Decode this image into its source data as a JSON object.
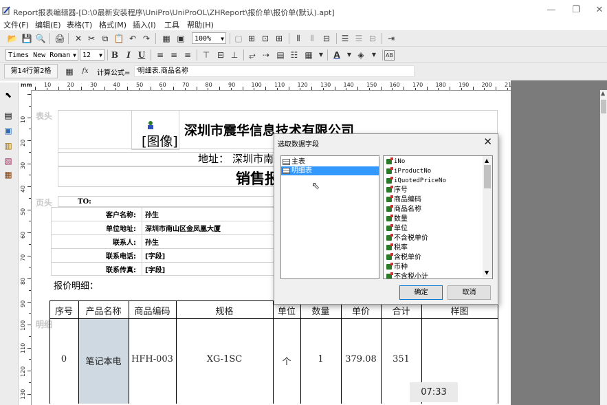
{
  "window": {
    "title": "Report报表编辑器-[D:\\0最新安装程序\\UniPro\\UniProOL\\ZHReport\\报价单\\报价单(默认).apt]",
    "minimize": "—",
    "restore": "❐",
    "close": "✕"
  },
  "menu": [
    "文件(F)",
    "编辑(E)",
    "表格(T)",
    "格式(M)",
    "插入(I)",
    "工具",
    "帮助(H)"
  ],
  "toolbar": {
    "zoom": "100%"
  },
  "format": {
    "font": "Times New Roman",
    "size": "12",
    "bold": "B",
    "italic": "I",
    "underline": "U",
    "text_color_letter": "A",
    "ab": "AB"
  },
  "formula": {
    "cell_position": "第14行第2格",
    "fx": "fx",
    "label": "计算公式=",
    "value": "'明细表.商品名称"
  },
  "ruler": {
    "unit": "mm",
    "h_labels": [
      "10",
      "20",
      "30",
      "40",
      "50",
      "60",
      "70",
      "80",
      "90",
      "100",
      "110",
      "120",
      "130",
      "140",
      "150",
      "160",
      "170",
      "180",
      "190",
      "200",
      "210"
    ],
    "v_labels": [
      "10",
      "20",
      "30",
      "40",
      "50",
      "60",
      "70",
      "80",
      "90",
      "100",
      "110",
      "120",
      "130"
    ]
  },
  "report": {
    "band_header": "表头",
    "band_page": "页头",
    "band_detail": "明细",
    "image_placeholder": "[图像]",
    "company": "深圳市震华信息技术有限公司",
    "address_label": "地址：",
    "address_value": "深圳市南",
    "doc_title": "销售报",
    "to_label": "TO:",
    "fields": [
      {
        "label": "客户名称:",
        "value": "孙生"
      },
      {
        "label": "单位地址:",
        "value": "深圳市南山区金凤凰大厦"
      },
      {
        "label": "联系人:",
        "value": "孙生"
      },
      {
        "label": "联系电话:",
        "value": "[字段]"
      },
      {
        "label": "联系传真:",
        "value": "[字段]"
      }
    ],
    "detail_caption": "报价明细：",
    "table_headers": [
      "序号",
      "产品名称",
      "商品编码",
      "规格",
      "单位",
      "数量",
      "单价",
      "合计",
      "样图"
    ],
    "row": [
      "0",
      "笔记本电",
      "HFH-003",
      "XG-1SC",
      "个",
      "1",
      "379.08",
      "351",
      ""
    ]
  },
  "dialog": {
    "title": "选取数据字段",
    "close": "✕",
    "tables": [
      "主表",
      "明细表"
    ],
    "selected_table": "明细表",
    "fields": [
      "iNo",
      "iProductNo",
      "iQuotedPriceNo",
      "序号",
      "商品编码",
      "商品名称",
      "数量",
      "单位",
      "不含税单价",
      "税率",
      "含税单价",
      "币种",
      "不含税小计"
    ],
    "ok": "确定",
    "cancel": "取消"
  },
  "clock": "07:33"
}
